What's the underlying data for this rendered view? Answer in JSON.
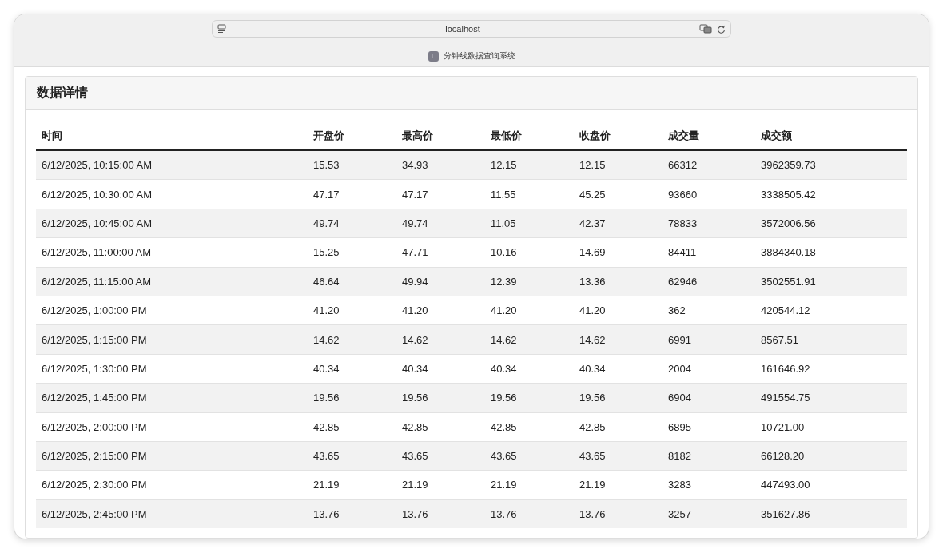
{
  "browser": {
    "address": "localhost",
    "tab": {
      "badge": "L",
      "title": "分钟线数据查询系统"
    }
  },
  "card": {
    "title": "数据详情"
  },
  "table": {
    "columns": [
      "时间",
      "开盘价",
      "最高价",
      "最低价",
      "收盘价",
      "成交量",
      "成交额"
    ],
    "rows": [
      [
        "6/12/2025, 10:15:00 AM",
        "15.53",
        "34.93",
        "12.15",
        "12.15",
        "66312",
        "3962359.73"
      ],
      [
        "6/12/2025, 10:30:00 AM",
        "47.17",
        "47.17",
        "11.55",
        "45.25",
        "93660",
        "3338505.42"
      ],
      [
        "6/12/2025, 10:45:00 AM",
        "49.74",
        "49.74",
        "11.05",
        "42.37",
        "78833",
        "3572006.56"
      ],
      [
        "6/12/2025, 11:00:00 AM",
        "15.25",
        "47.71",
        "10.16",
        "14.69",
        "84411",
        "3884340.18"
      ],
      [
        "6/12/2025, 11:15:00 AM",
        "46.64",
        "49.94",
        "12.39",
        "13.36",
        "62946",
        "3502551.91"
      ],
      [
        "6/12/2025, 1:00:00 PM",
        "41.20",
        "41.20",
        "41.20",
        "41.20",
        "362",
        "420544.12"
      ],
      [
        "6/12/2025, 1:15:00 PM",
        "14.62",
        "14.62",
        "14.62",
        "14.62",
        "6991",
        "8567.51"
      ],
      [
        "6/12/2025, 1:30:00 PM",
        "40.34",
        "40.34",
        "40.34",
        "40.34",
        "2004",
        "161646.92"
      ],
      [
        "6/12/2025, 1:45:00 PM",
        "19.56",
        "19.56",
        "19.56",
        "19.56",
        "6904",
        "491554.75"
      ],
      [
        "6/12/2025, 2:00:00 PM",
        "42.85",
        "42.85",
        "42.85",
        "42.85",
        "6895",
        "10721.00"
      ],
      [
        "6/12/2025, 2:15:00 PM",
        "43.65",
        "43.65",
        "43.65",
        "43.65",
        "8182",
        "66128.20"
      ],
      [
        "6/12/2025, 2:30:00 PM",
        "21.19",
        "21.19",
        "21.19",
        "21.19",
        "3283",
        "447493.00"
      ],
      [
        "6/12/2025, 2:45:00 PM",
        "13.76",
        "13.76",
        "13.76",
        "13.76",
        "3257",
        "351627.86"
      ]
    ]
  }
}
